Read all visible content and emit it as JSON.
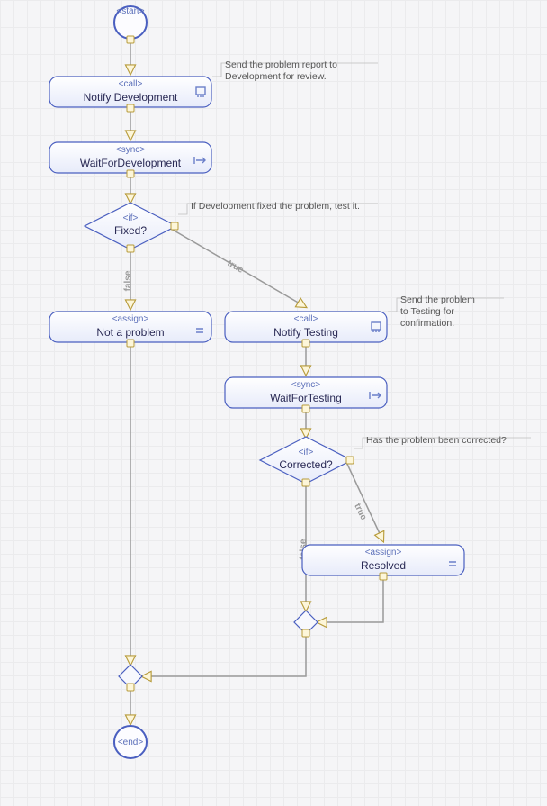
{
  "nodes": {
    "start": {
      "stereo": "<start>",
      "note": ""
    },
    "notifyDev": {
      "stereo": "<call>",
      "label": "Notify Development",
      "note": "Send the problem report to\nDevelopment for review."
    },
    "waitDev": {
      "stereo": "<sync>",
      "label": "WaitForDevelopment"
    },
    "fixed": {
      "stereo": "<if>",
      "label": "Fixed?",
      "note": "If Development fixed the problem, test it."
    },
    "notAProblem": {
      "stereo": "<assign>",
      "label": "Not a problem"
    },
    "notifyTest": {
      "stereo": "<call>",
      "label": "Notify Testing",
      "note": "Send the problem\nto Testing for\nconfirmation."
    },
    "waitTest": {
      "stereo": "<sync>",
      "label": "WaitForTesting"
    },
    "corrected": {
      "stereo": "<if>",
      "label": "Corrected?",
      "note": "Has the problem been corrected?"
    },
    "resolved": {
      "stereo": "<assign>",
      "label": "Resolved"
    },
    "end": {
      "stereo": "<end>"
    }
  },
  "edges": {
    "fixedTrue": "true",
    "fixedFalse": "false",
    "corrTrue": "true",
    "corrFalse": "false"
  },
  "colors": {
    "nodeStroke": "#4a5fc0",
    "edge": "#9a9a9a"
  }
}
